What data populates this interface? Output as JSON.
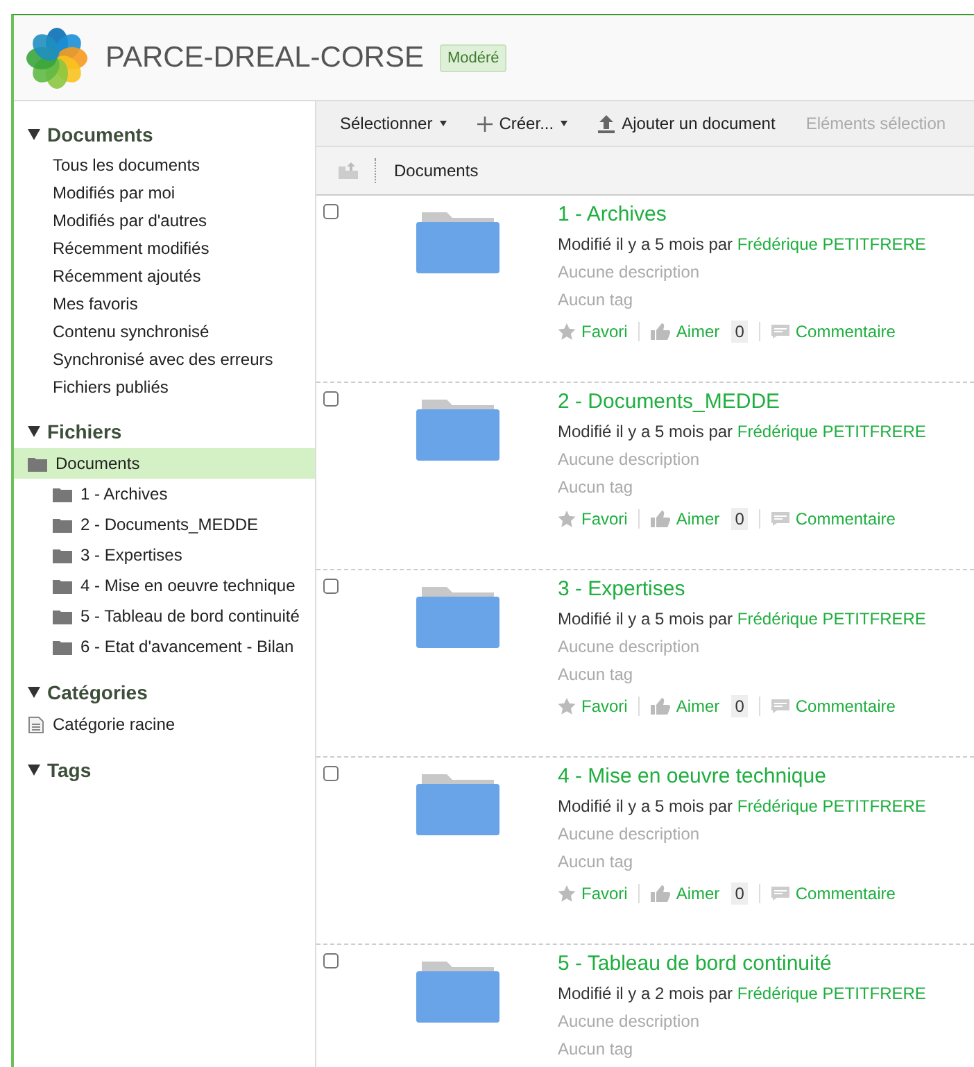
{
  "site": {
    "title": "PARCE-DREAL-CORSE",
    "badge": "Modéré"
  },
  "sidebar": {
    "sections": [
      {
        "kind": "list",
        "title": "Documents",
        "expanded": true,
        "items": [
          "Tous les documents",
          "Modifiés par moi",
          "Modifiés par d'autres",
          "Récemment modifiés",
          "Récemment ajoutés",
          "Mes favoris",
          "Contenu synchronisé",
          "Synchronisé avec des erreurs",
          "Fichiers publiés"
        ]
      },
      {
        "kind": "tree",
        "title": "Fichiers",
        "expanded": true,
        "tree": [
          {
            "label": "Documents",
            "selected": true,
            "children": [
              {
                "label": "1 - Archives",
                "selected": false
              },
              {
                "label": "2 - Documents_MEDDE",
                "selected": false
              },
              {
                "label": "3 - Expertises",
                "selected": false
              },
              {
                "label": "4 - Mise en oeuvre technique",
                "selected": false
              },
              {
                "label": "5 - Tableau de bord continuité",
                "selected": false
              },
              {
                "label": "6 - Etat d'avancement - Bilan",
                "selected": false
              }
            ]
          }
        ]
      },
      {
        "kind": "categories",
        "title": "Catégories",
        "expanded": true,
        "items": [
          "Catégorie racine"
        ]
      },
      {
        "kind": "list",
        "title": "Tags",
        "expanded": true
      }
    ]
  },
  "toolbar": [
    {
      "label": "Sélectionner",
      "kind": "menu",
      "disabled": false
    },
    {
      "label": "Créer...",
      "kind": "create",
      "disabled": false
    },
    {
      "label": "Ajouter un document",
      "kind": "upload",
      "disabled": false
    },
    {
      "label": "Eléments sélection",
      "kind": "plain",
      "disabled": true
    }
  ],
  "breadcrumb": "Documents",
  "documents": [
    {
      "title": "1 - Archives",
      "checked": false,
      "modified": "Modifié il y a 5 mois par",
      "author": "Frédérique PETITFRERE",
      "description": "Aucune description",
      "tags": "Aucun tag",
      "actions": {
        "favorite": "Favori",
        "like": "Aimer",
        "likes": "0",
        "comment": "Commentaire"
      }
    },
    {
      "title": "2 - Documents_MEDDE",
      "checked": false,
      "modified": "Modifié il y a 5 mois par",
      "author": "Frédérique PETITFRERE",
      "description": "Aucune description",
      "tags": "Aucun tag",
      "actions": {
        "favorite": "Favori",
        "like": "Aimer",
        "likes": "0",
        "comment": "Commentaire"
      }
    },
    {
      "title": "3 - Expertises",
      "checked": false,
      "modified": "Modifié il y a 5 mois par",
      "author": "Frédérique PETITFRERE",
      "description": "Aucune description",
      "tags": "Aucun tag",
      "actions": {
        "favorite": "Favori",
        "like": "Aimer",
        "likes": "0",
        "comment": "Commentaire"
      }
    },
    {
      "title": "4 - Mise en oeuvre technique",
      "checked": false,
      "modified": "Modifié il y a 5 mois par",
      "author": "Frédérique PETITFRERE",
      "description": "Aucune description",
      "tags": "Aucun tag",
      "actions": {
        "favorite": "Favori",
        "like": "Aimer",
        "likes": "0",
        "comment": "Commentaire"
      }
    },
    {
      "title": "5 - Tableau de bord continuité",
      "checked": false,
      "modified": "Modifié il y a 2 mois par",
      "author": "Frédérique PETITFRERE",
      "description": "Aucune description",
      "tags": "Aucun tag"
    }
  ]
}
